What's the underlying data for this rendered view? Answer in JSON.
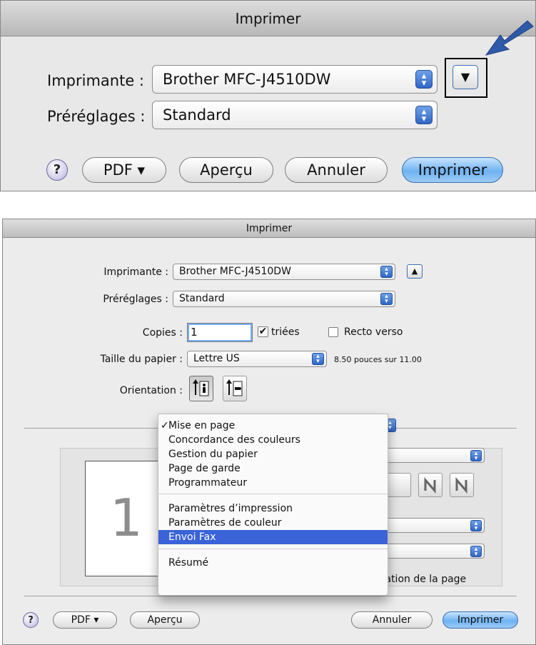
{
  "dialog1": {
    "title": "Imprimer",
    "printer_label": "Imprimante :",
    "printer_value": "Brother MFC-J4510DW",
    "presets_label": "Préréglages :",
    "presets_value": "Standard",
    "help": "?",
    "pdf": "PDF ▾",
    "preview": "Aperçu",
    "cancel": "Annuler",
    "print": "Imprimer",
    "disclosure_icon": "▼"
  },
  "dialog2": {
    "title": "Imprimer",
    "printer_label": "Imprimante :",
    "printer_value": "Brother MFC-J4510DW",
    "presets_label": "Préréglages :",
    "presets_value": "Standard",
    "copies_label": "Copies :",
    "copies_value": "1",
    "collated_label": "triées",
    "collated_checked": true,
    "duplex_label": "Recto verso",
    "duplex_checked": false,
    "paper_label": "Taille du papier :",
    "paper_value": "Lettre US",
    "paper_size_text": "8.50 pouces sur 11.00",
    "orientation_label": "Orientation :",
    "collapse_icon": "▲",
    "preview_page": "1",
    "partial_e": "e",
    "partial_orientation": "tation de la page",
    "help": "?",
    "pdf": "PDF ▾",
    "preview": "Aperçu",
    "cancel": "Annuler",
    "print": "Imprimer",
    "menu": {
      "group1": [
        "Mise en page",
        "Concordance des couleurs",
        "Gestion du papier",
        "Page de garde",
        "Programmateur"
      ],
      "group2": [
        "Paramètres d’impression",
        "Paramètres de couleur",
        "Envoi Fax"
      ],
      "group3": [
        "Résumé"
      ],
      "checked_item": "Mise en page",
      "highlighted_item": "Envoi Fax",
      "checkmark": "✓"
    }
  },
  "colors": {
    "accent_blue": "#2f66c6",
    "menu_highlight": "#3a63d8",
    "arrow": "#2e5aa8"
  }
}
